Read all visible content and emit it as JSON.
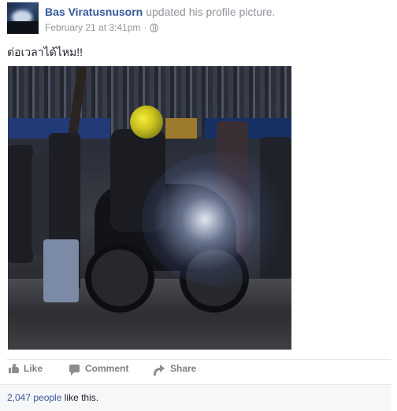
{
  "post": {
    "author": "Bas Viratusnusorn",
    "action": "updated his profile picture.",
    "timestamp": "February 21 at 3:41pm",
    "separator": "·",
    "privacy_icon": "globe-icon",
    "caption": "ต่อเวลาได้ไหม!!"
  },
  "actions": {
    "like_label": "Like",
    "comment_label": "Comment",
    "share_label": "Share"
  },
  "likes": {
    "count": "2,047 people",
    "suffix": " like this."
  },
  "colors": {
    "link": "#365899",
    "meta": "#90949c",
    "action": "#7f7f7f",
    "likes_bg": "#f6f7f9"
  }
}
